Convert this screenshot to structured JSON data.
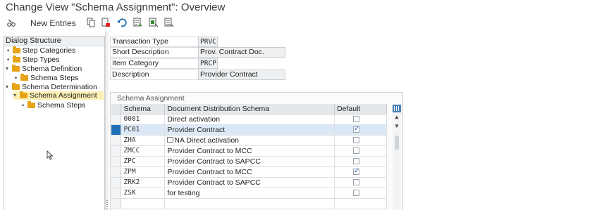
{
  "window": {
    "title": "Change View \"Schema Assignment\": Overview"
  },
  "toolbar": {
    "new_entries_label": "New Entries",
    "icons": [
      "pen-glasses-icon",
      "copy-icon",
      "delete-icon",
      "undo-icon",
      "select-all-icon",
      "select-block-icon",
      "deselect-all-icon"
    ]
  },
  "dialog_structure": {
    "title": "Dialog Structure",
    "items": [
      {
        "label": "Step Categories"
      },
      {
        "label": "Step Types"
      },
      {
        "label": "Schema Definition"
      },
      {
        "label": "Schema Steps"
      },
      {
        "label": "Schema Determination"
      },
      {
        "label": "Schema Assignment",
        "selected": true
      },
      {
        "label": "Schema Steps"
      }
    ]
  },
  "header_fields": [
    {
      "label": "Transaction Type",
      "value": "PRVC"
    },
    {
      "label": "Short Description",
      "value": "Prov. Contract Doc."
    },
    {
      "label": "Item Category",
      "value": "PRCP"
    },
    {
      "label": "Description",
      "value": "Provider Contract"
    }
  ],
  "table": {
    "section_title": "Schema Assignment",
    "columns": [
      "Schema",
      "Document Distribution Schema",
      "Default"
    ],
    "rows": [
      {
        "schema": "0001",
        "dds": "Direct activation",
        "default": false,
        "active": false
      },
      {
        "schema": "PC01",
        "dds": "Provider Contract",
        "default": true,
        "active": true
      },
      {
        "schema": "ZHA",
        "dds": "NA Direct activation",
        "default": false,
        "active": false
      },
      {
        "schema": "ZMCC",
        "dds": "Provider Contract to MCC",
        "default": false,
        "active": false
      },
      {
        "schema": "ZPC",
        "dds": "Provider Contract to SAPCC",
        "default": false,
        "active": false
      },
      {
        "schema": "ZPM",
        "dds": "Provider Contract to MCC",
        "default": true,
        "active": false
      },
      {
        "schema": "ZRK2",
        "dds": "Provider Contract to SAPCC",
        "default": false,
        "active": false
      },
      {
        "schema": "ZSK",
        "dds": "for testing",
        "default": false,
        "active": false
      },
      {
        "schema": "",
        "dds": "",
        "default": null,
        "active": false
      }
    ]
  },
  "colors": {
    "selection_blue": "#1f6fb5",
    "tree_selected": "#fdf0b4",
    "folder": "#e8a317"
  }
}
